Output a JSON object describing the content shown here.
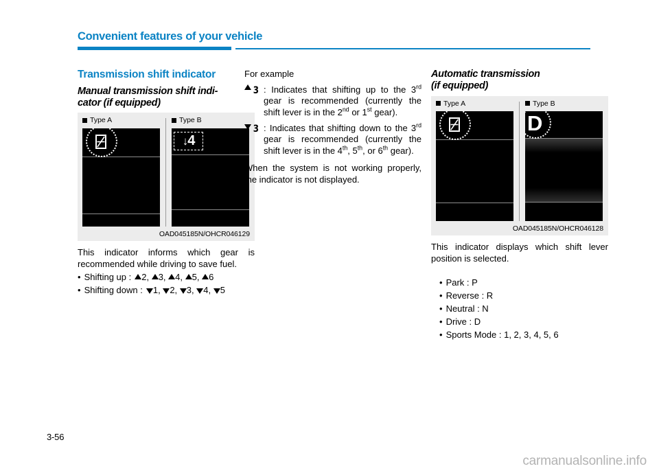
{
  "header": {
    "title": "Convenient features of your vehicle",
    "accent_color": "#0b83c4"
  },
  "page_number": "3-56",
  "watermark": "carmanualsonline.info",
  "left_column": {
    "section_title": "Transmission shift indicator",
    "sub_title": "Manual transmission shift indi-cator (if equipped)",
    "figure": {
      "type_a_label": "Type A",
      "type_b_label": "Type B",
      "type_a_icon": "gear-shift-badge-icon",
      "type_b_badge_arrow": "↓",
      "type_b_badge_digit": "4",
      "caption": "OAD045185N/OHCR046129"
    },
    "paragraph": "This indicator informs which gear is recommended while driving to save fuel.",
    "bullets": [
      {
        "label": "Shifting up :",
        "direction": "up",
        "values": [
          "2",
          "3",
          "4",
          "5",
          "6"
        ]
      },
      {
        "label": "Shifting down :",
        "direction": "down",
        "values": [
          "1",
          "2",
          "3",
          "4",
          "5"
        ]
      }
    ]
  },
  "middle_column": {
    "intro": "For example",
    "examples": [
      {
        "direction": "up",
        "gear_glyph": "3",
        "colon": ":",
        "text_part1": "Indicates that shifting up to the 3",
        "sup1": "rd",
        "text_part2": " gear is recommended (currently the shift lever is in the 2",
        "sup2": "nd",
        "text_part3": " or 1",
        "sup3": "st",
        "text_part4": " gear)."
      },
      {
        "direction": "down",
        "gear_glyph": "3",
        "colon": ":",
        "text_part1": "Indicates that shifting down to the 3",
        "sup1": "rd",
        "text_part2": " gear is recommended (currently the shift lever is in the 4",
        "sup2": "th",
        "text_part3": ", 5",
        "sup3": "th",
        "text_part4": ", or 6",
        "sup4": "th",
        "text_part5": " gear)."
      }
    ],
    "note": "When the system is not working properly, the indicator is not displayed."
  },
  "right_column": {
    "sub_title": "Automatic transmission (if equipped)",
    "figure": {
      "type_a_label": "Type A",
      "type_b_label": "Type B",
      "type_a_icon": "gear-shift-badge-icon",
      "type_b_letter": "D",
      "caption": "OAD045185N/OHCR046128"
    },
    "paragraph": "This indicator displays which shift lever position is selected.",
    "bullets": [
      "Park : P",
      "Reverse : R",
      "Neutral : N",
      "Drive : D",
      "Sports Mode : 1, 2, 3, 4, 5, 6"
    ]
  }
}
